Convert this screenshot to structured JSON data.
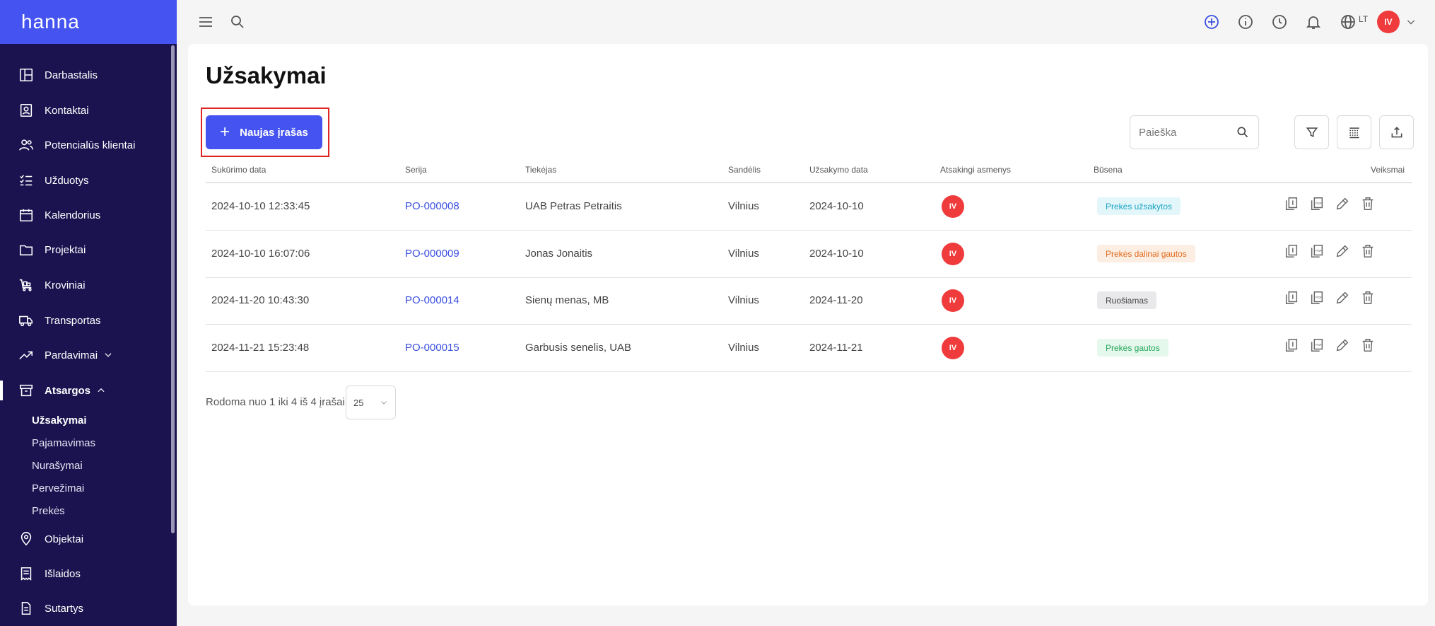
{
  "brand": "hanna",
  "sidebar": {
    "items": [
      {
        "label": "Darbastalis",
        "icon": "dashboard-icon"
      },
      {
        "label": "Kontaktai",
        "icon": "contacts-icon"
      },
      {
        "label": "Potencialūs klientai",
        "icon": "users-icon"
      },
      {
        "label": "Užduotys",
        "icon": "tasks-icon"
      },
      {
        "label": "Kalendorius",
        "icon": "calendar-icon"
      },
      {
        "label": "Projektai",
        "icon": "folder-icon"
      },
      {
        "label": "Kroviniai",
        "icon": "cart-icon"
      },
      {
        "label": "Transportas",
        "icon": "truck-icon"
      },
      {
        "label": "Pardavimai",
        "icon": "trend-icon"
      },
      {
        "label": "Atsargos",
        "icon": "archive-icon"
      },
      {
        "label": "Objektai",
        "icon": "location-icon"
      },
      {
        "label": "Išlaidos",
        "icon": "receipt-icon"
      },
      {
        "label": "Sutartys",
        "icon": "document-icon"
      }
    ],
    "subitems": [
      {
        "label": "Užsakymai"
      },
      {
        "label": "Pajamavimas"
      },
      {
        "label": "Nurašymai"
      },
      {
        "label": "Pervežimai"
      },
      {
        "label": "Prekės"
      }
    ]
  },
  "topbar": {
    "lang": "LT",
    "avatar": "IV"
  },
  "page": {
    "title": "Užsakymai",
    "new_button": "Naujas įrašas",
    "search_placeholder": "Paieška"
  },
  "table": {
    "columns": [
      "Sukūrimo data",
      "Serija",
      "Tiekėjas",
      "Sandėlis",
      "Užsakymo data",
      "Atsakingi asmenys",
      "Būsena",
      "Veiksmai"
    ],
    "rows": [
      {
        "created": "2024-10-10 12:33:45",
        "series": "PO-000008",
        "supplier": "UAB Petras Petraitis",
        "warehouse": "Vilnius",
        "order_date": "2024-10-10",
        "responsible": "IV",
        "status": "Prekės užsakytos",
        "status_bg": "#e3f7fb",
        "status_fg": "#1aa3c2"
      },
      {
        "created": "2024-10-10 16:07:06",
        "series": "PO-000009",
        "supplier": "Jonas Jonaitis",
        "warehouse": "Vilnius",
        "order_date": "2024-10-10",
        "responsible": "IV",
        "status": "Prekės dalinai gautos",
        "status_bg": "#fdeee3",
        "status_fg": "#e06a1b"
      },
      {
        "created": "2024-11-20 10:43:30",
        "series": "PO-000014",
        "supplier": "Sienų menas, MB",
        "warehouse": "Vilnius",
        "order_date": "2024-11-20",
        "responsible": "IV",
        "status": "Ruošiamas",
        "status_bg": "#e9e9ec",
        "status_fg": "#444444"
      },
      {
        "created": "2024-11-21 15:23:48",
        "series": "PO-000015",
        "supplier": "Garbusis senelis, UAB",
        "warehouse": "Vilnius",
        "order_date": "2024-11-21",
        "responsible": "IV",
        "status": "Prekės gautos",
        "status_bg": "#e5f8ec",
        "status_fg": "#22a559"
      }
    ]
  },
  "pager": {
    "text": "Rodoma nuo 1 iki 4 iš 4 įrašai",
    "per_page": "25"
  }
}
